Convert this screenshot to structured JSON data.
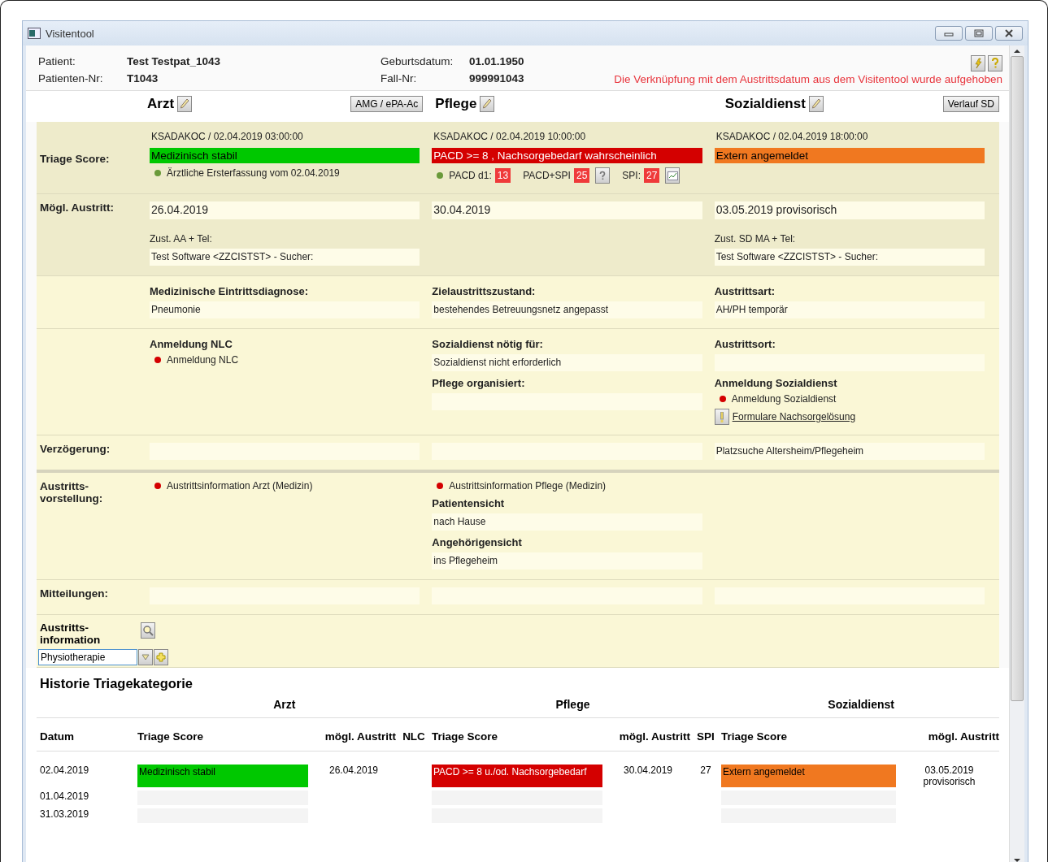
{
  "window": {
    "title": "Visitentool"
  },
  "patient": {
    "fields": [
      {
        "label": "Patient:",
        "value": "Test Testpat_1043"
      },
      {
        "label": "Geburtsdatum:",
        "value": "01.01.1950"
      },
      {
        "label": "Patienten-Nr:",
        "value": "T1043"
      },
      {
        "label": "Fall-Nr:",
        "value": "999991043"
      }
    ],
    "notice": "Die Verknüpfung mit dem Austrittsdatum aus dem Visitentool wurde aufgehoben"
  },
  "columns": [
    {
      "title": "Arzt",
      "button": "AMG / ePA-Ac"
    },
    {
      "title": "Pflege"
    },
    {
      "title": "Sozialdienst",
      "button": "Verlauf SD"
    }
  ],
  "rows": [
    {
      "label": "Triage Score:",
      "cells": [
        [
          {
            "kind": "meta",
            "text": "KSADAKOC / 02.04.2019 03:00:00"
          },
          {
            "kind": "score",
            "text": "Medizinisch stabil",
            "color": "#00c800"
          },
          {
            "kind": "status",
            "text": "Ärztliche Ersterfassung vom 02.04.2019",
            "color": "#6a9a3a"
          }
        ],
        [
          {
            "kind": "meta",
            "text": "KSADAKOC / 02.04.2019 10:00:00"
          },
          {
            "kind": "score",
            "text": "PACD >= 8 , Nachsorgebedarf wahrscheinlich",
            "color": "#d40000"
          },
          {
            "kind": "badges",
            "color": "#6a9a3a",
            "badges": [
              {
                "label": "PACD d1:",
                "value": "13"
              },
              {
                "label": "PACD+SPI",
                "value": "25"
              },
              {
                "label": "SPI:",
                "value": "27"
              }
            ]
          }
        ],
        [
          {
            "kind": "meta",
            "text": "KSADAKOC / 02.04.2019 18:00:00"
          },
          {
            "kind": "score",
            "text": "Extern angemeldet",
            "color": "#f07820"
          }
        ]
      ]
    },
    {
      "label": "Mögl. Austritt:",
      "cells": [
        [
          {
            "kind": "date",
            "text": "26.04.2019"
          },
          {
            "kind": "note",
            "text": "Zust. AA + Tel:"
          },
          {
            "kind": "field",
            "text": "Test Software <ZZCISTST> - Sucher:"
          }
        ],
        [
          {
            "kind": "date",
            "text": "30.04.2019"
          }
        ],
        [
          {
            "kind": "date",
            "text": "03.05.2019  provisorisch"
          },
          {
            "kind": "note",
            "text": "Zust. SD MA + Tel:"
          },
          {
            "kind": "field",
            "text": "Test Software <ZZCISTST> - Sucher:"
          }
        ]
      ]
    },
    {
      "cells": [
        [
          {
            "kind": "heading",
            "text": "Medizinische Eintrittsdiagnose:"
          },
          {
            "kind": "field",
            "text": "Pneumonie"
          }
        ],
        [
          {
            "kind": "heading",
            "text": "Zielaustrittszustand:"
          },
          {
            "kind": "field",
            "text": "bestehendes Betreuungsnetz angepasst"
          }
        ],
        [
          {
            "kind": "heading",
            "text": "Austrittsart:"
          },
          {
            "kind": "field",
            "text": "AH/PH temporär"
          }
        ]
      ]
    },
    {
      "cells": [
        [
          {
            "kind": "heading",
            "text": "Anmeldung NLC"
          },
          {
            "kind": "status",
            "text": "Anmeldung NLC",
            "color": "#d40000"
          }
        ],
        [
          {
            "kind": "heading",
            "text": "Sozialdienst nötig für:"
          },
          {
            "kind": "field",
            "text": "Sozialdienst nicht erforderlich"
          },
          {
            "kind": "heading",
            "text": "Pflege organisiert:"
          },
          {
            "kind": "field"
          }
        ],
        [
          {
            "kind": "heading",
            "text": "Austrittsort:"
          },
          {
            "kind": "field"
          },
          {
            "kind": "heading",
            "text": "Anmeldung Sozialdienst"
          },
          {
            "kind": "status",
            "text": "Anmeldung Sozialdienst",
            "color": "#d40000"
          },
          {
            "kind": "link",
            "text": "Formulare Nachsorgelösung"
          }
        ]
      ]
    },
    {
      "label": "Verzögerung:",
      "cells": [
        [
          {
            "kind": "field"
          }
        ],
        [
          {
            "kind": "field"
          }
        ],
        [
          {
            "kind": "field",
            "text": "Platzsuche Altersheim/Pflegeheim"
          }
        ]
      ]
    },
    {
      "label": "Austritts-vorstellung:",
      "cells": [
        [
          {
            "kind": "status",
            "text": "Austrittsinformation Arzt (Medizin)",
            "color": "#d40000"
          }
        ],
        [
          {
            "kind": "status",
            "text": "Austrittsinformation Pflege (Medizin)",
            "color": "#d40000"
          },
          {
            "kind": "heading",
            "text": "Patientensicht"
          },
          {
            "kind": "field",
            "text": "nach Hause"
          },
          {
            "kind": "heading",
            "text": "Angehörigensicht"
          },
          {
            "kind": "field",
            "text": "ins Pflegeheim"
          }
        ],
        []
      ]
    },
    {
      "label": "Mitteilungen:",
      "cells": [
        [
          {
            "kind": "field"
          }
        ],
        [
          {
            "kind": "field"
          }
        ],
        [
          {
            "kind": "field"
          }
        ]
      ]
    }
  ],
  "discharge_info": {
    "label": "Austritts-information",
    "value": "Physiotherapie"
  },
  "history": {
    "title": "Historie Triagekategorie",
    "groups": [
      "Arzt",
      "Pflege",
      "Sozialdienst"
    ],
    "columns": [
      "Datum",
      "Triage Score",
      "mögl. Austritt",
      "NLC",
      "Triage Score",
      "mögl. Austritt",
      "SPI",
      "Triage Score",
      "mögl. Austritt"
    ],
    "rows": [
      [
        {
          "kind": "text",
          "text": "02.04.2019"
        },
        {
          "kind": "score",
          "text": "Medizinisch stabil",
          "color": "#00c800"
        },
        {
          "kind": "text",
          "text": "26.04.2019"
        },
        {
          "kind": "blank"
        },
        {
          "kind": "score",
          "text": "PACD >= 8 u./od. Nachsorgebedarf",
          "color": "#d40000"
        },
        {
          "kind": "text",
          "text": "30.04.2019"
        },
        {
          "kind": "text",
          "text": "27"
        },
        {
          "kind": "score",
          "text": "Extern angemeldet",
          "color": "#f07820"
        },
        {
          "kind": "text",
          "text": "03.05.2019 provisorisch"
        }
      ],
      [
        {
          "kind": "text",
          "text": "01.04.2019"
        },
        {
          "kind": "empty-score"
        },
        {
          "kind": "blank"
        },
        {
          "kind": "blank"
        },
        {
          "kind": "empty-score"
        },
        {
          "kind": "blank"
        },
        {
          "kind": "blank"
        },
        {
          "kind": "empty-score"
        },
        {
          "kind": "blank"
        }
      ],
      [
        {
          "kind": "text",
          "text": "31.03.2019"
        },
        {
          "kind": "empty-score"
        },
        {
          "kind": "blank"
        },
        {
          "kind": "blank"
        },
        {
          "kind": "empty-score"
        },
        {
          "kind": "blank"
        },
        {
          "kind": "blank"
        },
        {
          "kind": "empty-score"
        },
        {
          "kind": "blank"
        }
      ]
    ]
  }
}
